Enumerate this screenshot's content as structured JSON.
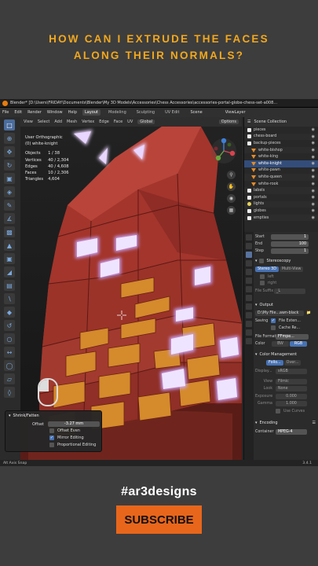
{
  "headline": {
    "line1": "HOW CAN I EXTRUDE THE FACES",
    "line2": "ALONG THEIR NORMALS?"
  },
  "blender": {
    "title": "Blender* [D:\\Users\\FRIDAY\\Documents\\Blender\\My 3D Models\\Accessories\\Chess Accessories\\accessories-portal-globe-chess-set-a008...",
    "menus": [
      "File",
      "Edit",
      "Render",
      "Window",
      "Help"
    ],
    "workspaces": [
      "Layout",
      "Modeling",
      "Sculpting",
      "UV Edit"
    ],
    "active_workspace": "Layout",
    "scene": "Scene",
    "view_layer": "ViewLayer",
    "viewport_header": {
      "items": [
        "View",
        "Select",
        "Add",
        "Mesh",
        "Vertex",
        "Edge",
        "Face",
        "UV"
      ],
      "transform": "Global",
      "options": "Options"
    },
    "viewport": {
      "view_name": "User Orthographic",
      "object_name": "(0) white-knight",
      "stats": [
        {
          "label": "Objects",
          "value": "1 / 38"
        },
        {
          "label": "Vertices",
          "value": "40 / 2,304"
        },
        {
          "label": "Edges",
          "value": "40 / 4,608"
        },
        {
          "label": "Faces",
          "value": "10 / 2,306"
        },
        {
          "label": "Triangles",
          "value": "4,604"
        }
      ]
    },
    "operator_panel": {
      "title": "Shrink/Fatten",
      "offset_label": "Offset",
      "offset_value": "-3.27 mm",
      "even_label": "Offset Even",
      "even_checked": false,
      "mirror_label": "Mirror Editing",
      "mirror_checked": true,
      "proportional_label": "Proportional Editing",
      "proportional_checked": false
    },
    "outliner": {
      "header": "Scene Collection",
      "items": [
        {
          "name": "Scene Collection",
          "icon": "collection",
          "selected": false
        },
        {
          "name": "pieces",
          "icon": "collection",
          "selected": false
        },
        {
          "name": "chess-board",
          "icon": "collection",
          "selected": false
        },
        {
          "name": "backup-pieces",
          "icon": "collection",
          "selected": false
        },
        {
          "name": "white-bishop",
          "icon": "mesh",
          "selected": false
        },
        {
          "name": "white-king",
          "icon": "mesh",
          "selected": false
        },
        {
          "name": "white-knight",
          "icon": "mesh",
          "selected": true
        },
        {
          "name": "white-pawn",
          "icon": "mesh",
          "selected": false
        },
        {
          "name": "white-queen",
          "icon": "mesh",
          "selected": false
        },
        {
          "name": "white-rook",
          "icon": "mesh",
          "selected": false
        },
        {
          "name": "labels",
          "icon": "collection",
          "selected": false
        },
        {
          "name": "portals",
          "icon": "collection",
          "selected": false
        },
        {
          "name": "lights",
          "icon": "light",
          "selected": false
        },
        {
          "name": "globes",
          "icon": "collection",
          "selected": false
        },
        {
          "name": "empties",
          "icon": "collection",
          "selected": false
        }
      ]
    },
    "frame": {
      "start_label": "Start",
      "start_value": "1",
      "end_label": "End",
      "end_value": "100",
      "step_label": "Step",
      "step_value": "1"
    },
    "properties": {
      "stereoscopy": "Stereoscopy",
      "stereo_modes": [
        "Stereo 3D",
        "Multi-View"
      ],
      "left_label": "left",
      "right_label": "right",
      "file_suffix_label": "File Suffix",
      "file_suffix_value": "_L",
      "output": "Output",
      "output_path": "D:\\My File...awn-black",
      "saving_label": "Saving",
      "file_ext_label": "File Exten...",
      "cache_label": "Cache Re...",
      "file_format_label": "File Format",
      "file_format_value": "FFmpe...",
      "color_label": "Color",
      "color_modes": [
        "BW",
        "RGB"
      ],
      "color_active": "RGB",
      "color_mgmt": "Color Management",
      "cm_modes": [
        "Follo...",
        "Over..."
      ],
      "display_label": "Display...",
      "display_value": "sRGB",
      "view_label": "View",
      "view_value": "Filmic",
      "look_label": "Look",
      "look_value": "None",
      "exposure_label": "Exposure",
      "exposure_value": "0.000",
      "gamma_label": "Gamma",
      "gamma_value": "1.000",
      "curves_label": "Use Curves",
      "encoding": "Encoding",
      "container_label": "Container",
      "container_value": "MPEG-4"
    },
    "status": {
      "left": "Alt  Axis Snap",
      "version": "3.4.1"
    }
  },
  "footer": {
    "hashtag": "#ar3designs",
    "subscribe": "SUBSCRIBE"
  },
  "colors": {
    "accent": "#f2a81d",
    "subscribe_bg": "#e8661b",
    "knight_red": "#a83a30",
    "face_orange": "#d1892b",
    "glow": "#e7d8ff"
  }
}
